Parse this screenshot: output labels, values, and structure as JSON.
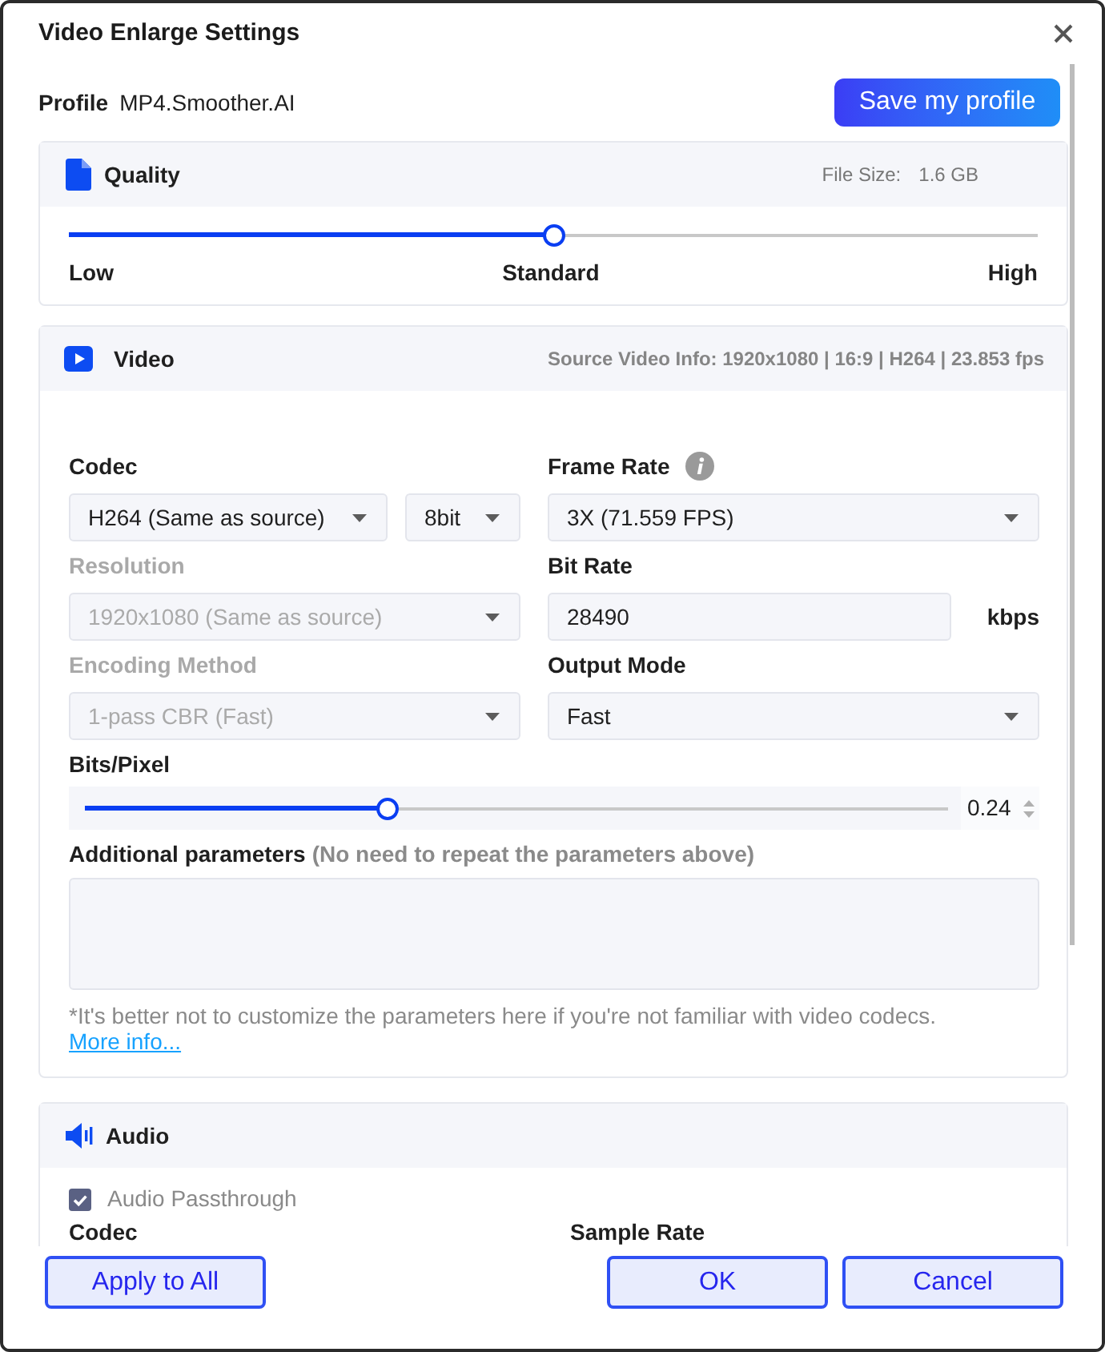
{
  "window": {
    "title": "Video Enlarge Settings"
  },
  "profile": {
    "label": "Profile",
    "value": "MP4.Smoother.AI",
    "save_button": "Save my profile"
  },
  "quality": {
    "title": "Quality",
    "file_size_label": "File Size:",
    "file_size": "1.6 GB",
    "slider": {
      "level": 0.5
    },
    "marks": [
      "Low",
      "Standard",
      "High"
    ]
  },
  "video": {
    "title": "Video",
    "source_info": "Source Video Info: 1920x1080 | 16:9 | H264 | 23.853 fps",
    "fields": [
      {
        "kind": "select",
        "label": "Codec",
        "disabled": false,
        "selects": [
          "H264 (Same as source)",
          "8bit"
        ]
      },
      {
        "kind": "select",
        "label": "Frame Rate",
        "info_icon": true,
        "disabled": false,
        "selects": [
          "3X (71.559 FPS)"
        ]
      },
      {
        "kind": "select",
        "label": "Resolution",
        "disabled": true,
        "selects": [
          "1920x1080 (Same as source)"
        ]
      },
      {
        "kind": "input",
        "label": "Bit Rate",
        "disabled": false,
        "value": "28490",
        "unit": "kbps"
      },
      {
        "kind": "select",
        "label": "Encoding Method",
        "disabled": true,
        "selects": [
          "1-pass CBR (Fast)"
        ]
      },
      {
        "kind": "select",
        "label": "Output Mode",
        "disabled": false,
        "selects": [
          "Fast"
        ]
      }
    ],
    "bits_per_pixel": {
      "label": "Bits/Pixel",
      "level": 0.35,
      "value": "0.24"
    },
    "additional_parameters": {
      "label": "Additional parameters",
      "hint": "(No need to repeat the parameters above)"
    },
    "note": {
      "text": "*It's better not to customize the parameters here if you're not familiar with video codecs.",
      "link": "More info..."
    }
  },
  "audio": {
    "title": "Audio",
    "passthrough": {
      "label": "Audio Passthrough",
      "checked": true
    },
    "field_labels": [
      "Codec",
      "Sample Rate"
    ]
  },
  "footer": {
    "left_buttons": [
      "Apply to All"
    ],
    "right_buttons": [
      "OK",
      "Cancel"
    ]
  }
}
